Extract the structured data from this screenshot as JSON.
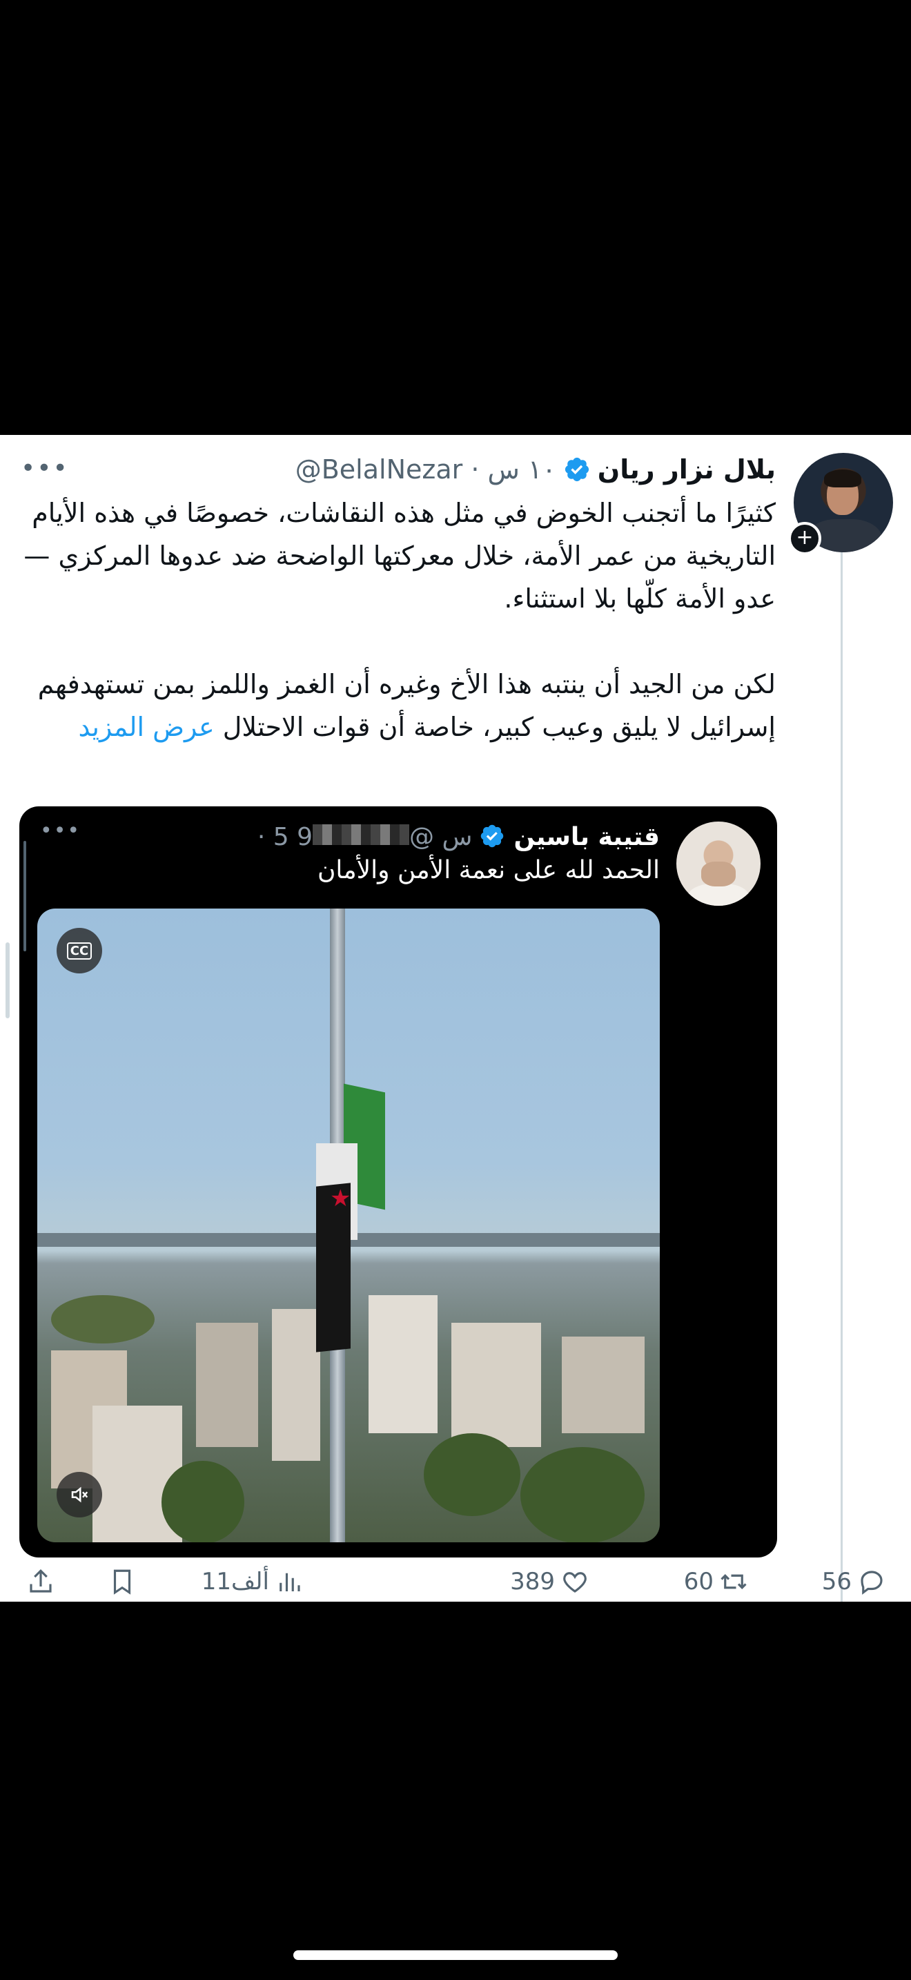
{
  "author": {
    "name": "بلال نزار ريان",
    "handle_time": "@BelalNezar · ١٠ س"
  },
  "tweet": {
    "paragraph1": "كثيرًا ما أتجنب الخوض في مثل هذه النقاشات، خصوصًا في هذه الأيام التاريخية من عمر الأمة، خلال معركتها الواضحة ضد عدوها المركزي — عدو الأمة كلّها بلا استثناء.",
    "paragraph2_text": "لكن من الجيد أن ينتبه هذا الأخ وغيره أن الغمز واللمز بمن تستهدفهم إسرائيل لا يليق وعيب كبير، خاصة أن قوات الاحتلال",
    "show_more": "عرض المزيد"
  },
  "quote": {
    "name": "قتيبة باسين",
    "handle_prefix": "@",
    "handle_suffix": "9",
    "time": "· 5 س",
    "text": "الحمد لله على نعمة الأمن والأمان"
  },
  "actions": {
    "replies": "56",
    "retweets": "60",
    "likes": "389",
    "views": "11ألف"
  },
  "colors": {
    "accent": "#1d9bf0",
    "text": "#0f1419",
    "muted": "#536471"
  }
}
